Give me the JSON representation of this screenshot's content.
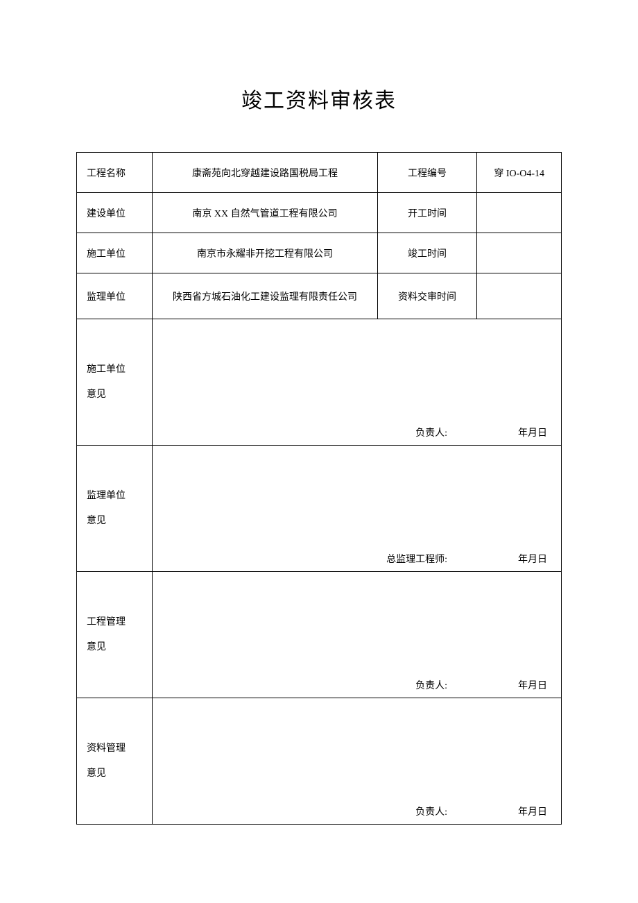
{
  "title": "竣工资料审核表",
  "headerRows": [
    {
      "label": "工程名称",
      "value": "康斋苑向北穿越建设路国税局工程",
      "label2": "工程编号",
      "value2": "穿 IO-O4-14"
    },
    {
      "label": "建设单位",
      "value": "南京 XX 自然气管道工程有限公司",
      "label2": "开工时间",
      "value2": ""
    },
    {
      "label": "施工单位",
      "value": "南京市永耀非开挖工程有限公司",
      "label2": "竣工时间",
      "value2": ""
    },
    {
      "label": "监理单位",
      "value": "陕西省方城石油化工建设监理有限责任公司",
      "label2": "资料交审时间",
      "value2": ""
    }
  ],
  "opinionRows": [
    {
      "labelLine1": "施工单位",
      "labelLine2": "意见",
      "signer": "负责人:",
      "date": "年月日"
    },
    {
      "labelLine1": "监理单位",
      "labelLine2": "意见",
      "signer": "总监理工程师:",
      "date": "年月日"
    },
    {
      "labelLine1": "工程管理",
      "labelLine2": "意见",
      "signer": "负责人:",
      "date": "年月日"
    },
    {
      "labelLine1": "资料管理",
      "labelLine2": "意见",
      "signer": "负责人:",
      "date": "年月日"
    }
  ]
}
